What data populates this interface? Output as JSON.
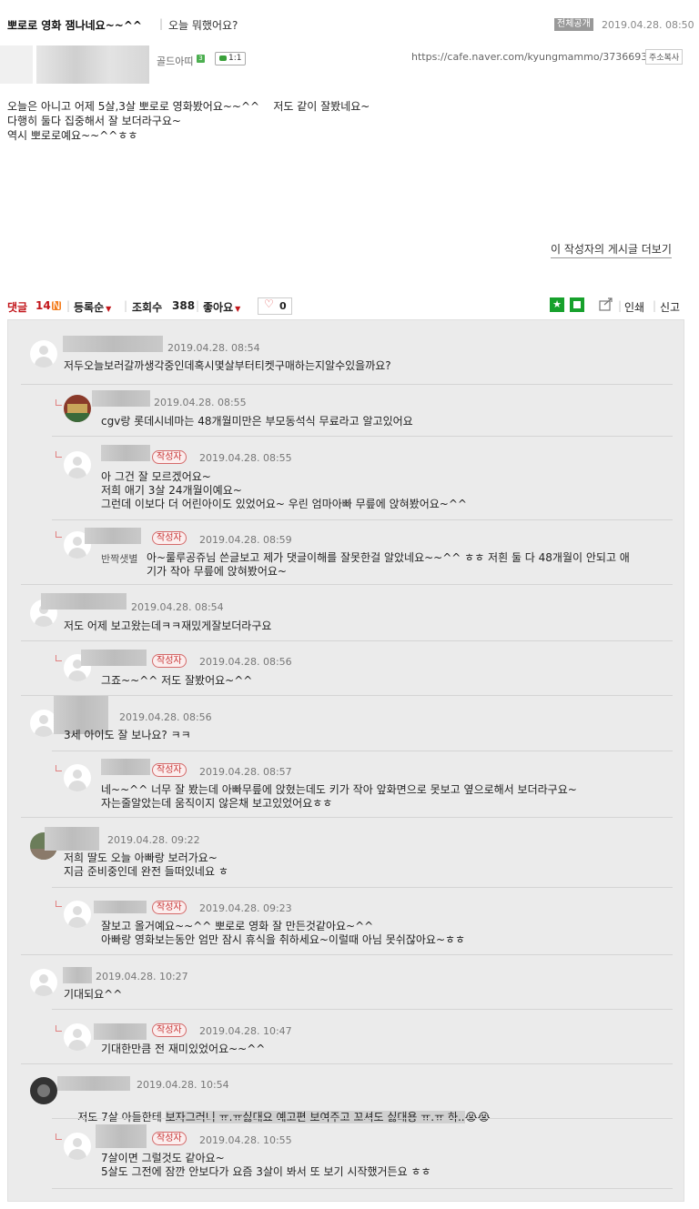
{
  "post": {
    "title": "뽀로로 영화 잼나네요~~^^",
    "category": "오늘 뭐했어요?",
    "visibility": "전체공개",
    "date": "2019.04.28. 08:50",
    "author": "골드아띠",
    "author_level": "3",
    "chat_label": "1:1",
    "url": "https://cafe.naver.com/kyungmammo/3736693",
    "copy_label": "주소복사",
    "body": [
      "오늘은 아니고 어제 5살,3살 뽀로로 영화봤어요~~^^    저도 같이 잘봤네요~",
      "다행히 둘다 집중해서 잘 보더라구요~",
      "역시 뽀로로예요~~^^ㅎㅎ"
    ],
    "more_posts": "이 작성자의 게시글 더보기"
  },
  "toolbar": {
    "comment_label": "댓글",
    "comment_count": "14",
    "new_badge": "N",
    "sort_label": "등록순",
    "views_label": "조회수",
    "views_count": "388",
    "like_label": "좋아요",
    "likes": "0",
    "print_label": "인쇄",
    "report_label": "신고"
  },
  "writer_badge": "작성자",
  "comments": [
    {
      "time": "2019.04.28. 08:54",
      "text": "저두오늘보러갈까생각중인데혹시몇살부터티켓구매하는지알수있을까요?"
    },
    {
      "time": "2019.04.28. 08:55",
      "text": "cgv랑 롯데시네마는 48개월미만은 부모동석식 무료라고 알고있어요"
    },
    {
      "time": "2019.04.28. 08:55",
      "text": "아 그건 잘 모르겠어요~\n저희 애기 3살 24개월이예요~\n그런데 이보다 더 어린아이도 있었어요~ 우린 엄마아빠 무릎에 앉혀봤어요~^^"
    },
    {
      "time": "2019.04.28. 08:59",
      "nick": "반짝샛별",
      "text": "아~룰루공쥬님 쓴글보고 제가 댓글이해를 잘못한걸 알았네요~~^^ ㅎㅎ 저흰 둘 다 48개월이 안되고 애\n기가 작아 무릎에 앉혀봤어요~"
    },
    {
      "time": "2019.04.28. 08:54",
      "text": "저도 어제 보고왔는데ㅋㅋ재밌게잘보더라구요"
    },
    {
      "time": "2019.04.28. 08:56",
      "text": "그죠~~^^ 저도 잘봤어요~^^"
    },
    {
      "time": "2019.04.28. 08:56",
      "text": "3세 아이도 잘 보나요? ㅋㅋ"
    },
    {
      "time": "2019.04.28. 08:57",
      "text": "네~~^^ 너무 잘 봤는데 아빠무릎에 앉혔는데도 키가 작아 앞화면으로 못보고 옆으로해서 보더라구요~\n자는줄알았는데 움직이지 않은채 보고있었어요ㅎㅎ"
    },
    {
      "time": "2019.04.28. 09:22",
      "text": "저희 딸도 오늘 아빠랑 보러가요~\n지금 준비중인데 완전 들떠있네요 ㅎ"
    },
    {
      "time": "2019.04.28. 09:23",
      "text": "잘보고 올거예요~~^^ 뽀로로 영화 잘 만든것같아요~^^\n아빠랑 영화보는동안 엄만 잠시 휴식을 취하세요~이럴때 아님 못쉬잖아요~ㅎㅎ"
    },
    {
      "time": "2019.04.28. 10:27",
      "text": "기대되요^^"
    },
    {
      "time": "2019.04.28. 10:47",
      "text": "기대한만큼 전 재미있었어요~~^^"
    },
    {
      "time": "2019.04.28. 10:54",
      "text_a": "저도 7살 아들한테 ",
      "text_b": "보자그러니 ㅠ.ㅠ싫대요 예고편 보여주고 꼬셔도 싫대용 ㅠ.ㅠ 하..",
      "emoji": "😭😭"
    },
    {
      "time": "2019.04.28. 10:55",
      "text": "7살이면 그럴것도 같아요~\n5살도 그전에 잠깐 안보다가 요즘 3살이 봐서 또 보기 시작했거든요 ㅎㅎ"
    }
  ],
  "colors": {
    "accent": "#c2161b",
    "green": "#17a12c",
    "comment_bg": "#ebebeb",
    "writer_badge": "#c83737"
  }
}
